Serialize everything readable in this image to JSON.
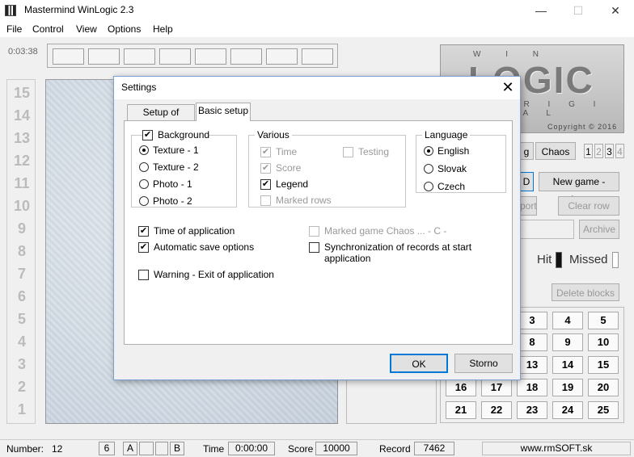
{
  "window": {
    "title": "Mastermind WinLogic 2.3",
    "minimize": "—",
    "maximize": "☐",
    "close": "✕"
  },
  "menu": [
    "File",
    "Control",
    "View",
    "Options",
    "Help"
  ],
  "toolbar": {
    "timer": "0:03:38"
  },
  "row_numbers": [
    "15",
    "14",
    "13",
    "12",
    "11",
    "10",
    "9",
    "8",
    "7",
    "6",
    "5",
    "4",
    "3",
    "2",
    "1"
  ],
  "logo": {
    "top": "W I N",
    "main": "LOGIC",
    "bottom": "O R I G I N A L",
    "copyright": "Copyright © 2016"
  },
  "right_panel": {
    "mode_partial": "g",
    "mode_chaos": "Chaos",
    "levels": [
      "1",
      "2",
      "3",
      "4"
    ],
    "partial_button": "D",
    "new_game_player": "New game - player",
    "export_partial": "port",
    "clear_row": "Clear row",
    "archive": "Archive",
    "hit_label": "Hit",
    "missed_label": "Missed",
    "delete_blocks": "Delete blocks",
    "blocks": [
      "3",
      "4",
      "5",
      "8",
      "9",
      "10",
      "13",
      "14",
      "15",
      "16",
      "17",
      "18",
      "19",
      "20",
      "21",
      "22",
      "23",
      "24",
      "25"
    ]
  },
  "status": {
    "number_label": "Number:",
    "number_value": "12",
    "box_a": "6",
    "box_b": "A",
    "box_c": "",
    "box_d": "",
    "box_e": "B",
    "time_label": "Time",
    "time_value": "0:00:00",
    "score_label": "Score",
    "score_value": "10000",
    "record_label": "Record",
    "record_value": "7462",
    "website": "www.rmSOFT.sk"
  },
  "dialog": {
    "title": "Settings",
    "close": "✕",
    "tabs": [
      "Setup of games",
      "Basic setup"
    ],
    "background": {
      "label": "Background",
      "checked": true,
      "options": [
        "Texture - 1",
        "Texture - 2",
        "Photo - 1",
        "Photo - 2"
      ],
      "selected": "Texture - 1"
    },
    "various": {
      "label": "Various",
      "time": "Time",
      "testing": "Testing",
      "score": "Score",
      "legend": "Legend",
      "marked_rows": "Marked rows"
    },
    "language": {
      "label": "Language",
      "options": [
        "English",
        "Slovak",
        "Czech"
      ],
      "selected": "English"
    },
    "time_of_application": "Time of application",
    "automatic_save": "Automatic save options",
    "marked_game_chaos": "Marked game Chaos ... - C -",
    "sync_records": "Synchronization of records at start application",
    "warning_exit": "Warning - Exit of application",
    "ok": "OK",
    "cancel": "Storno"
  }
}
